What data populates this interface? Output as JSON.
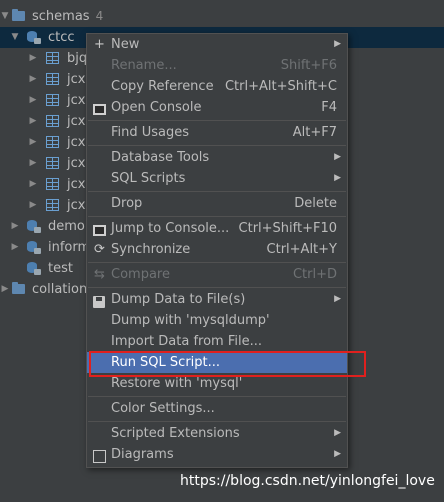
{
  "tree": {
    "schemas": {
      "label": "schemas",
      "count": "4"
    },
    "ctcc": {
      "label": "ctcc"
    },
    "tables": [
      "bjq",
      "jcxx",
      "jcxx",
      "jcxx",
      "jcxx",
      "jcxx",
      "jcxx",
      "jcxx"
    ],
    "demo": {
      "label": "demo"
    },
    "inform": {
      "label": "inform"
    },
    "test": {
      "label": "test"
    },
    "collations": {
      "label": "collations"
    }
  },
  "menu": {
    "new": {
      "label": "New"
    },
    "rename": {
      "label": "Rename...",
      "shortcut": "Shift+F6"
    },
    "copy_ref": {
      "label": "Copy Reference",
      "shortcut": "Ctrl+Alt+Shift+C"
    },
    "open_console": {
      "label": "Open Console",
      "shortcut": "F4"
    },
    "find_usages": {
      "label": "Find Usages",
      "shortcut": "Alt+F7"
    },
    "db_tools": {
      "label": "Database Tools"
    },
    "sql_scripts": {
      "label": "SQL Scripts"
    },
    "drop": {
      "label": "Drop",
      "shortcut": "Delete"
    },
    "jump_console": {
      "label": "Jump to Console...",
      "shortcut": "Ctrl+Shift+F10"
    },
    "synchronize": {
      "label": "Synchronize",
      "shortcut": "Ctrl+Alt+Y"
    },
    "compare": {
      "label": "Compare",
      "shortcut": "Ctrl+D"
    },
    "dump_file": {
      "label": "Dump Data to File(s)"
    },
    "dump_mysqldump": {
      "label": "Dump with 'mysqldump'"
    },
    "import_data": {
      "label": "Import Data from File..."
    },
    "run_sql": {
      "label": "Run SQL Script..."
    },
    "restore": {
      "label": "Restore with 'mysql'"
    },
    "color_settings": {
      "label": "Color Settings..."
    },
    "scripted_ext": {
      "label": "Scripted Extensions"
    },
    "diagrams": {
      "label": "Diagrams"
    }
  },
  "watermark": "https://blog.csdn.net/yinlongfei_love",
  "colors": {
    "highlight": "#4b6eaf",
    "annotation_box": "#e0201e",
    "background": "#3c3f41"
  },
  "icons": [
    "folder-icon",
    "database-icon",
    "table-icon",
    "plus-icon",
    "console-icon",
    "sync-icon",
    "compare-icon",
    "disk-icon",
    "diagram-icon",
    "submenu-arrow-icon"
  ]
}
